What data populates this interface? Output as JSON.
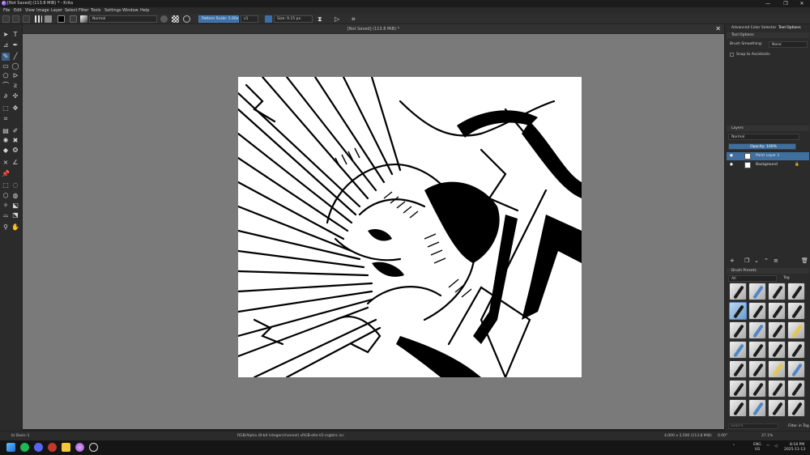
{
  "window": {
    "title": "[Not Saved]  (113.8 MiB) * - Krita",
    "minimize": "—",
    "maximize": "❐",
    "close": "✕"
  },
  "menu": [
    "File",
    "Edit",
    "View",
    "Image",
    "Layer",
    "Select",
    "Filter",
    "Tools",
    "Settings",
    "Window",
    "Help"
  ],
  "toolbar": {
    "blend_mode": "Normal",
    "pattern_scale": "Pattern Scale: 1.00x",
    "ratio": "x1",
    "size": "Size: 9.15 px"
  },
  "document": {
    "tab_title": "[Not Saved]  (113.8 MiB) *"
  },
  "docker": {
    "tabs": [
      "Advanced Color Selector",
      "Tool Options"
    ],
    "tool_options_title": "Tool Options",
    "brush_smoothing_label": "Brush Smoothing:",
    "brush_smoothing_value": "None",
    "snap_label": "Snap to Assistants",
    "layers_title": "Layers",
    "layer_blend": "Normal",
    "opacity": "Opacity:  100%",
    "layers": [
      {
        "name": "Paint Layer 1",
        "selected": true
      },
      {
        "name": "Background",
        "selected": false
      }
    ],
    "brush_presets_title": "Brush Presets",
    "preset_filter": "All",
    "tag_label": "Tag",
    "search_placeholder": "Search",
    "filter_in_tag": "Filter in Tag"
  },
  "status": {
    "brush": "b) Basic-1",
    "color_space": "RGB/Alpha (8-bit integer/channel)  sRGB-elle-V2-srgbtrc.icc",
    "dimensions": "4,000 x 3,500 (113.8 MiB)",
    "rotation": "0.00°",
    "zoom": "27.1%"
  },
  "taskbar": {
    "lang_top": "ENG",
    "lang_bottom": "US",
    "time": "8:18 PM",
    "date": "2025-11-13"
  }
}
